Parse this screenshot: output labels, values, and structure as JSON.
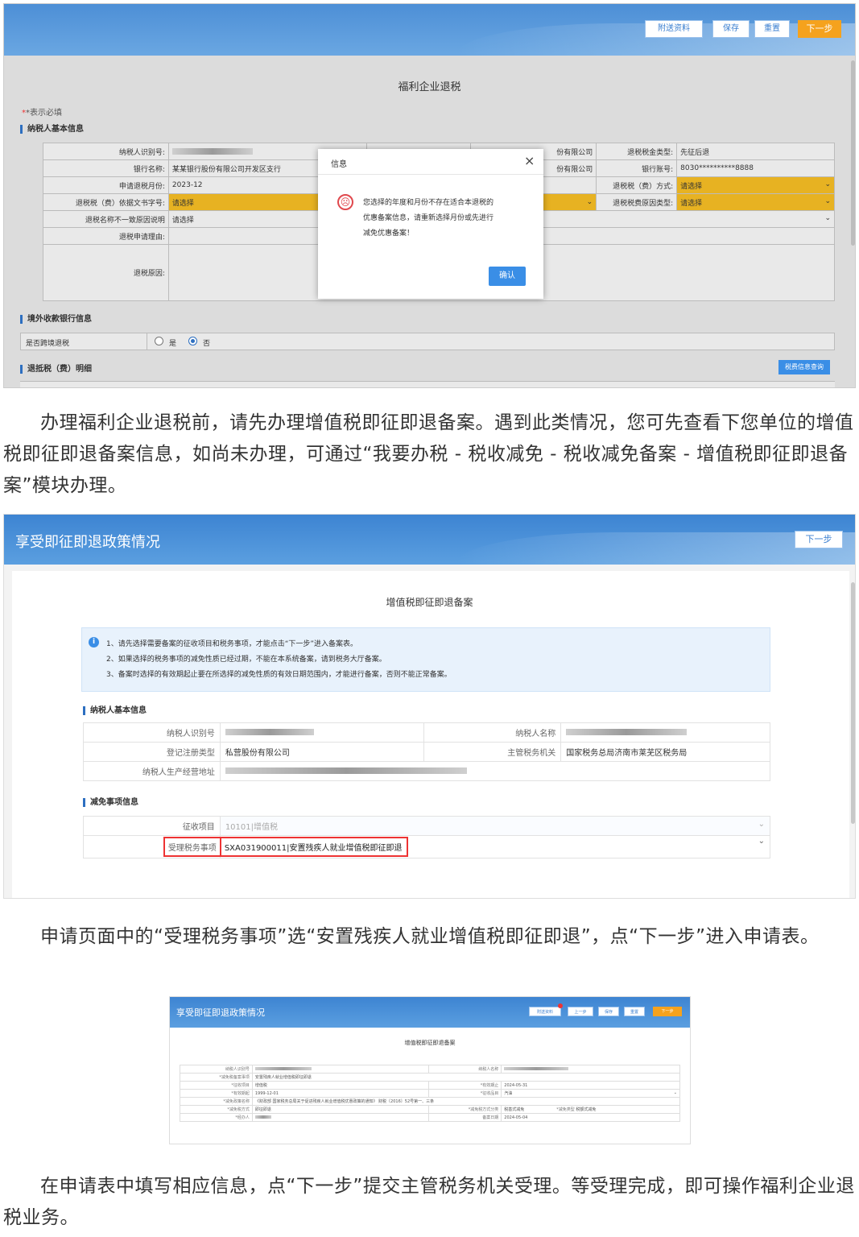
{
  "s1": {
    "buttons": {
      "attach": "附送资料",
      "save": "保存",
      "reset": "重置",
      "next": "下一步"
    },
    "title": "福利企业退税",
    "required_note": "*表示必填",
    "section_basic": "纳税人基本信息",
    "rows": [
      {
        "label": "纳税人识别号:",
        "mid_value": "份有限公司",
        "label2": "退税税金类型:",
        "value2": "先征后退"
      },
      {
        "label": "银行名称:",
        "value": "某某银行股份有限公司开发区支行",
        "mid_value": "份有限公司",
        "label2": "银行账号:",
        "value2": "8030**********8888"
      },
      {
        "label": "申请退税月份:",
        "value": "2023-12",
        "label2": "退税税（费）方式:",
        "value2": "请选择"
      },
      {
        "label": "退税税（费）依据文书字号:",
        "value": "请选择",
        "label2": "退税税费原因类型:",
        "value2": "请选择"
      },
      {
        "label": "退税名称不一致原因说明",
        "value": "请选择"
      },
      {
        "label": "退税申请理由:"
      },
      {
        "label": "退税原因:"
      }
    ],
    "section_bank": "境外收款银行信息",
    "overseas_label": "是否跨境退税",
    "radio_yes": "是",
    "radio_no": "否",
    "section_detail": "退抵税（费）明细",
    "detail_button": "税费信息查询",
    "dialog": {
      "title": "信息",
      "close": "×",
      "face": "☹",
      "lines": [
        "您选择的年度和月份不存在适合本退税的",
        "优惠备案信息，请重新选择月份或先进行",
        "减免优惠备案！"
      ],
      "ok": "确认"
    }
  },
  "para1": "办理福利企业退税前，请先办理增值税即征即退备案。遇到此类情况，您可先查看下您单位的增值税即征即退备案信息，如尚未办理，可通过“我要办税 - 税收减免 - 税收减免备案 - 增值税即征即退备案”模块办理。",
  "s2": {
    "header_title": "享受即征即退政策情况",
    "next": "下一步",
    "page_title": "增值税即征即退备案",
    "notice_icon": "i",
    "notice": [
      "1、请先选择需要备案的征收项目和税务事项，才能点击“下一步”进入备案表。",
      "2、如果选择的税务事项的减免性质已经过期，不能在本系统备案，请到税务大厅备案。",
      "3、备案时选择的有效期起止要在所选择的减免性质的有效日期范围内，才能进行备案，否则不能正常备案。"
    ],
    "section_basic": "纳税人基本信息",
    "basic": {
      "tin_label": "纳税人识别号",
      "name_label": "纳税人名称",
      "reg_type_label": "登记注册类型",
      "reg_type": "私营股份有限公司",
      "authority_label": "主管税务机关",
      "authority": "国家税务总局济南市莱芜区税务局",
      "address_label": "纳税人生产经营地址"
    },
    "section_relief": "减免事项信息",
    "relief": {
      "item_label": "征收项目",
      "item_value": "10101|增值税",
      "matter_label": "受理税务事项",
      "matter_value": "SXA031900011|安置残疾人就业增值税即征即退"
    }
  },
  "para2": "申请页面中的“受理税务事项”选“安置残疾人就业增值税即征即退”，点“下一步”进入申请表。",
  "s3": {
    "header_title": "享受即征即退政策情况",
    "buttons": [
      "附送资料",
      "上一步",
      "保存",
      "重置",
      "下一步"
    ],
    "page_title": "增值税即征即退备案",
    "rows": [
      [
        "纳税人识别号",
        "",
        "纳税人名称",
        ""
      ],
      [
        "*减免税备案事项",
        "安置残疾人就业增值税即征即退",
        "",
        ""
      ],
      [
        "*征收项目",
        "增值税",
        "*有效期止",
        "2024-05-31"
      ],
      [
        "*有效期起",
        "1999-12-01",
        "*征收品目",
        "汽油"
      ],
      [
        "*减免政策名称",
        "《财政部 国家税务总局关于促进残疾人就业增值税优惠政策的通知》 财税〔2016〕52号第一、三条",
        "",
        ""
      ],
      [
        "*减免税方式",
        "即征即退",
        "*减免税方式分类",
        "税基式减免",
        "*减免类型",
        "税额式减免"
      ],
      [
        "*经办人",
        "",
        "备案日期",
        "2024-05-04"
      ]
    ]
  },
  "para3": "在申请表中填写相应信息，点“下一步”提交主管税务机关受理。等受理完成，即可操作福利企业退税业务。"
}
